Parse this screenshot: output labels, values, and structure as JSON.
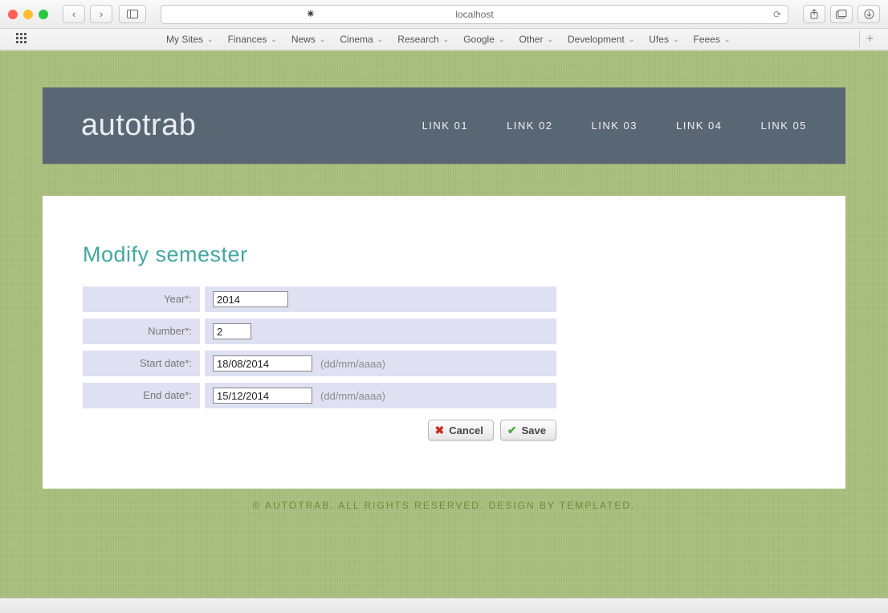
{
  "browser": {
    "address": "localhost",
    "bookmarks": [
      "My Sites",
      "Finances",
      "News",
      "Cinema",
      "Research",
      "Google",
      "Other",
      "Development",
      "Ufes",
      "Feees"
    ]
  },
  "site": {
    "title": "autotrab",
    "nav": [
      "LINK 01",
      "LINK 02",
      "LINK 03",
      "LINK 04",
      "LINK 05"
    ]
  },
  "page": {
    "heading": "Modify semester",
    "labels": {
      "year": "Year*:",
      "number": "Number*:",
      "start": "Start date*:",
      "end": "End date*:"
    },
    "values": {
      "year": "2014",
      "number": "2",
      "start": "18/08/2014",
      "end": "15/12/2014"
    },
    "hint": "(dd/mm/aaaa)",
    "buttons": {
      "cancel": "Cancel",
      "save": "Save"
    }
  },
  "footer": {
    "text_prefix": "© AUTOTRAB. ALL RIGHTS RESERVED. DESIGN BY ",
    "link": "TEMPLATED",
    "text_suffix": "."
  }
}
